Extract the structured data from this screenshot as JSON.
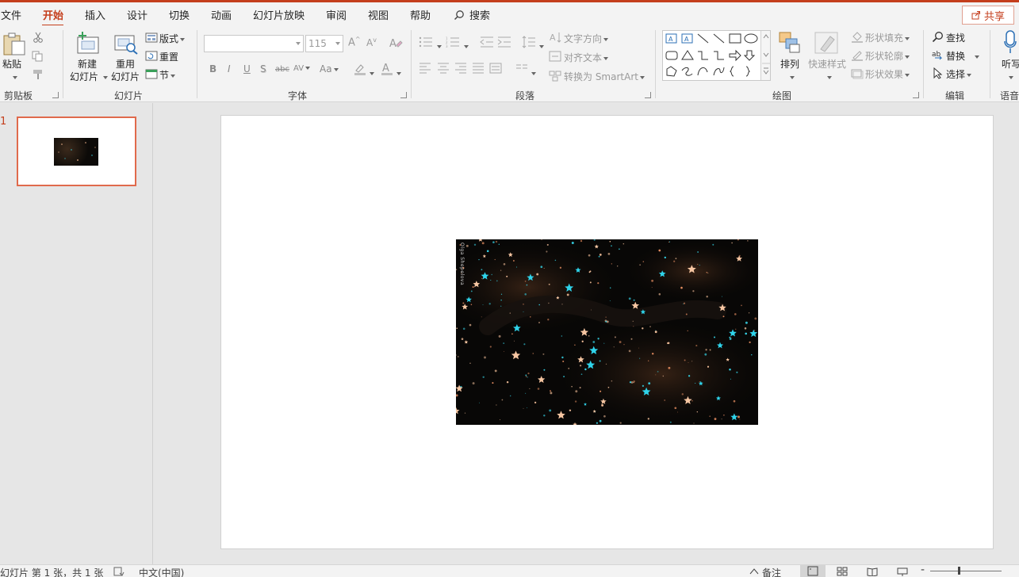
{
  "tabs": [
    {
      "label": "文件"
    },
    {
      "label": "开始"
    },
    {
      "label": "插入"
    },
    {
      "label": "设计"
    },
    {
      "label": "切换"
    },
    {
      "label": "动画"
    },
    {
      "label": "幻灯片放映"
    },
    {
      "label": "审阅"
    },
    {
      "label": "视图"
    },
    {
      "label": "帮助"
    }
  ],
  "search_label": "搜索",
  "share_label": "共享",
  "ribbon": {
    "clipboard": {
      "paste": "粘贴",
      "group": "剪贴板"
    },
    "slides": {
      "new_line1": "新建",
      "new_line2": "幻灯片",
      "reuse_line1": "重用",
      "reuse_line2": "幻灯片",
      "layout": "版式",
      "reset": "重置",
      "section": "节",
      "group": "幻灯片"
    },
    "font": {
      "font_name": "",
      "font_size": "115",
      "group": "字体",
      "bold": "B",
      "italic": "I",
      "underline": "U",
      "shadow": "S",
      "strike": "abc",
      "spacing": "AV",
      "case": "Aa"
    },
    "paragraph": {
      "text_direction": "文字方向",
      "align_text": "对齐文本",
      "smartart": "转换为 SmartArt",
      "group": "段落"
    },
    "drawing": {
      "arrange": "排列",
      "quick_styles": "快速样式",
      "fill": "形状填充",
      "outline": "形状轮廓",
      "effects": "形状效果",
      "group": "绘图"
    },
    "editing": {
      "find": "查找",
      "replace": "替换",
      "select": "选择",
      "group": "编辑"
    },
    "voice": {
      "dictate": "听写",
      "group": "语音"
    }
  },
  "thumbnail": {
    "number": "1"
  },
  "picture": {
    "caption": "Olga Shepelova"
  },
  "status": {
    "slide_info": "幻灯片 第 1 张，共 1 张",
    "language": "中文(中国)",
    "notes": "备注"
  },
  "colors": {
    "accent": "#c43e1c",
    "thumb_border": "#e06a4c"
  }
}
